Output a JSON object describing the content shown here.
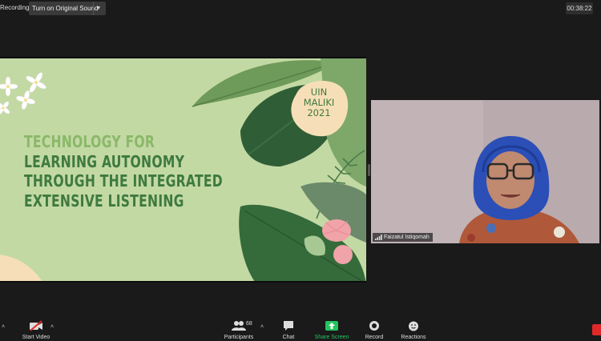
{
  "top_bar": {
    "recording_label": "Recording",
    "original_sound_button": "Turn on Original Sound",
    "elapsed_time": "00:38:22"
  },
  "slide": {
    "title_lines": [
      "TECHNOLOGY FOR",
      "LEARNING AUTONOMY",
      "THROUGH THE INTEGRATED",
      "EXTENSIVE LISTENING"
    ],
    "badge_lines": [
      "UIN",
      "MALIKI",
      "2021"
    ]
  },
  "participant_video": {
    "name": "Faizatul Istiqomah"
  },
  "toolbar": {
    "start_video": "Start Video",
    "participants": "Participants",
    "participants_count": "68",
    "chat": "Chat",
    "share_screen": "Share Screen",
    "record": "Record",
    "reactions": "Reactions"
  },
  "colors": {
    "background": "#1a1a1a",
    "slide_background": "#c3d9a4",
    "title_dark_green": "#3e7a3f",
    "title_light_green": "#8ab868",
    "share_screen_green": "#22c55e",
    "end_red": "#e02828"
  }
}
